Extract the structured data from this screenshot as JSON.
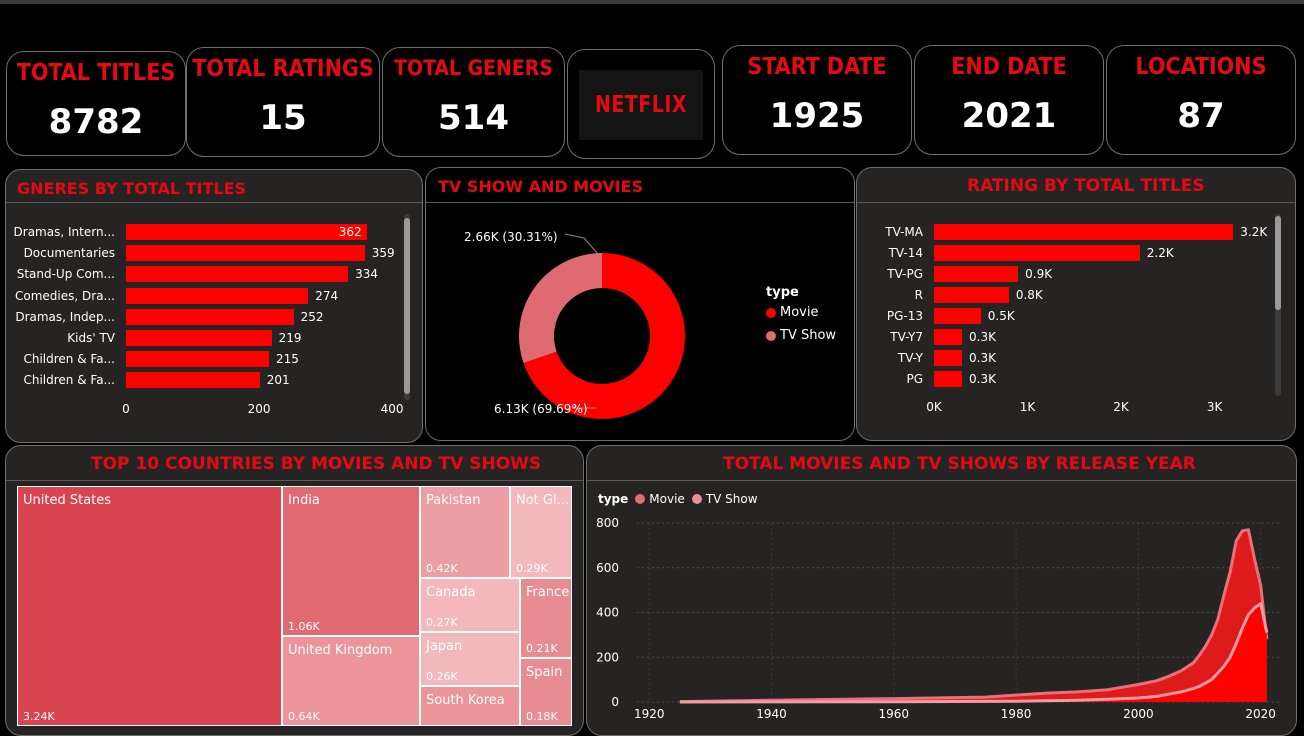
{
  "kpis": [
    {
      "label": "TOTAL TITLES",
      "value": "8782"
    },
    {
      "label": "TOTAL RATINGS",
      "value": "15"
    },
    {
      "label": "TOTAL GENERS",
      "value": "514"
    },
    {
      "label": "START DATE",
      "value": "1925"
    },
    {
      "label": "END DATE",
      "value": "2021"
    },
    {
      "label": "LOCATIONS",
      "value": "87"
    }
  ],
  "logo": "NETFLIX",
  "colors": {
    "accent": "#e50914",
    "movie": "#e01c2a",
    "tv_show": "#df6b72"
  },
  "genres_chart": {
    "title": "GNERES BY TOTAL TITLES",
    "xticks": [
      "0",
      "200",
      "400"
    ]
  },
  "donut_chart": {
    "title": "TV SHOW AND MOVIES",
    "tv_label": "2.66K (30.31%)",
    "movie_label": "6.13K (69.69%)",
    "legend_title": "type",
    "legend": [
      "Movie",
      "TV Show"
    ]
  },
  "rating_chart": {
    "title": "RATING BY TOTAL TITLES",
    "xticks": [
      "0K",
      "1K",
      "2K",
      "3K"
    ]
  },
  "treemap": {
    "title": "TOP 10 COUNTRIES BY MOVIES AND TV SHOWS"
  },
  "line_chart": {
    "title": "TOTAL MOVIES AND TV SHOWS BY RELEASE YEAR",
    "legend_title": "type",
    "legend": [
      "Movie",
      "TV Show"
    ],
    "yticks": [
      "0",
      "200",
      "400",
      "600",
      "800"
    ],
    "xticks": [
      "1920",
      "1940",
      "1960",
      "1980",
      "2000",
      "2020"
    ]
  },
  "chart_data": [
    {
      "type": "bar",
      "title": "GNERES BY TOTAL TITLES",
      "orientation": "horizontal",
      "categories": [
        "Dramas, Intern...",
        "Documentaries",
        "Stand-Up Com...",
        "Comedies, Dra...",
        "Dramas, Indep...",
        "Kids' TV",
        "Children & Fa...",
        "Children & Fa..."
      ],
      "values": [
        362,
        359,
        334,
        274,
        252,
        219,
        215,
        201
      ],
      "labels": [
        "362",
        "359",
        "334",
        "274",
        "252",
        "219",
        "215",
        "201"
      ],
      "xlim": [
        0,
        430
      ]
    },
    {
      "type": "pie",
      "title": "TV SHOW AND MOVIES",
      "donut": true,
      "categories": [
        "Movie",
        "TV Show"
      ],
      "values": [
        6130,
        2660
      ],
      "percent": [
        69.69,
        30.31
      ]
    },
    {
      "type": "bar",
      "title": "RATING BY TOTAL TITLES",
      "orientation": "horizontal",
      "categories": [
        "TV-MA",
        "TV-14",
        "TV-PG",
        "R",
        "PG-13",
        "TV-Y7",
        "TV-Y",
        "PG"
      ],
      "values": [
        3200,
        2200,
        900,
        800,
        500,
        300,
        300,
        300
      ],
      "labels": [
        "3.2K",
        "2.2K",
        "0.9K",
        "0.8K",
        "0.5K",
        "0.3K",
        "0.3K",
        "0.3K"
      ],
      "xlim": [
        0,
        3400
      ]
    },
    {
      "type": "treemap",
      "title": "TOP 10 COUNTRIES BY MOVIES AND TV SHOWS",
      "categories": [
        "United States",
        "India",
        "United Kingdom",
        "Pakistan",
        "Not Gi...",
        "Canada",
        "Japan",
        "South Korea",
        "France",
        "Spain"
      ],
      "values": [
        3240,
        1060,
        640,
        420,
        290,
        270,
        260,
        230,
        210,
        180
      ],
      "labels": [
        "3.24K",
        "1.06K",
        "0.64K",
        "0.42K",
        "0.29K",
        "0.27K",
        "0.26K",
        "",
        "0.21K",
        "0.18K"
      ]
    },
    {
      "type": "area",
      "title": "TOTAL MOVIES AND TV SHOWS BY RELEASE YEAR",
      "ylim": [
        0,
        800
      ],
      "xlim": [
        1918,
        2023
      ],
      "series": [
        {
          "name": "Movie",
          "x": [
            1925,
            1940,
            1960,
            1975,
            1985,
            1990,
            1995,
            2000,
            2003,
            2005,
            2007,
            2009,
            2010,
            2011,
            2012,
            2013,
            2014,
            2015,
            2016,
            2017,
            2018,
            2019,
            2020,
            2021
          ],
          "values": [
            2,
            8,
            15,
            22,
            40,
            45,
            55,
            78,
            95,
            115,
            140,
            175,
            210,
            250,
            300,
            370,
            480,
            580,
            720,
            765,
            770,
            640,
            520,
            280
          ]
        },
        {
          "name": "TV Show",
          "x": [
            1925,
            1960,
            1980,
            1990,
            1995,
            2000,
            2003,
            2005,
            2007,
            2009,
            2010,
            2011,
            2012,
            2013,
            2014,
            2015,
            2016,
            2017,
            2018,
            2019,
            2020,
            2021
          ],
          "values": [
            0,
            1,
            3,
            8,
            12,
            18,
            25,
            35,
            45,
            60,
            70,
            85,
            100,
            130,
            160,
            200,
            260,
            330,
            390,
            420,
            440,
            310
          ]
        }
      ]
    }
  ]
}
